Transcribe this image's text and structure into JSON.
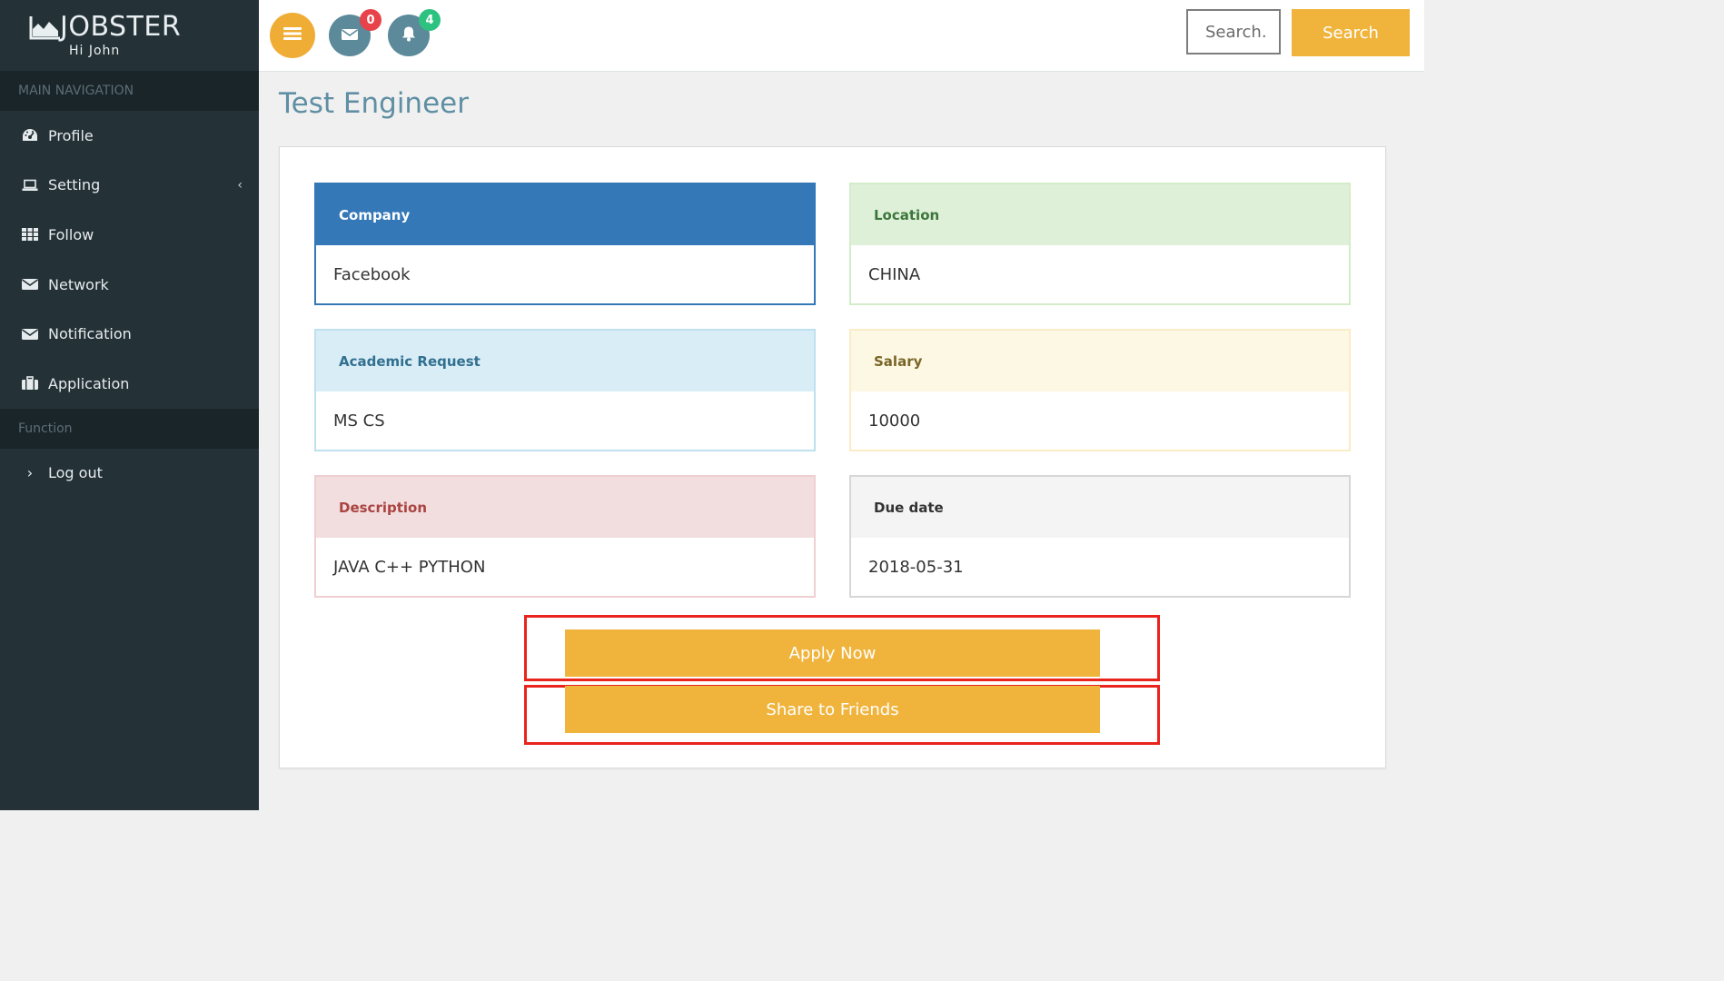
{
  "brand": {
    "name": "JOBSTER",
    "greeting": "Hi John"
  },
  "sidebar": {
    "main_header": "MAIN NAVIGATION",
    "items": [
      {
        "label": "Profile",
        "icon": "dashboard-icon"
      },
      {
        "label": "Setting",
        "icon": "laptop-icon"
      },
      {
        "label": "Follow",
        "icon": "grid-icon"
      },
      {
        "label": "Network",
        "icon": "envelope-icon"
      },
      {
        "label": "Notification",
        "icon": "envelope-icon"
      },
      {
        "label": "Application",
        "icon": "briefcase-icon"
      }
    ],
    "function_header": "Function",
    "logout": {
      "label": "Log out",
      "icon": "chevron-right-icon"
    }
  },
  "topbar": {
    "mail_count": "0",
    "notification_count": "4",
    "search_placeholder": "Search.",
    "search_button": "Search"
  },
  "job": {
    "title": "Test Engineer",
    "company": {
      "label": "Company",
      "value": "Facebook"
    },
    "location": {
      "label": "Location",
      "value": "CHINA"
    },
    "academic": {
      "label": "Academic Request",
      "value": "MS CS"
    },
    "salary": {
      "label": "Salary",
      "value": "10000"
    },
    "description": {
      "label": "Description",
      "value": "JAVA C++ PYTHON"
    },
    "due_date": {
      "label": "Due date",
      "value": "2018-05-31"
    }
  },
  "actions": {
    "apply": "Apply Now",
    "share": "Share to Friends"
  },
  "colors": {
    "accent": "#f0b43c",
    "sidebar_bg": "#243238",
    "primary": "#3478b8",
    "highlight_border": "#e8241c"
  }
}
